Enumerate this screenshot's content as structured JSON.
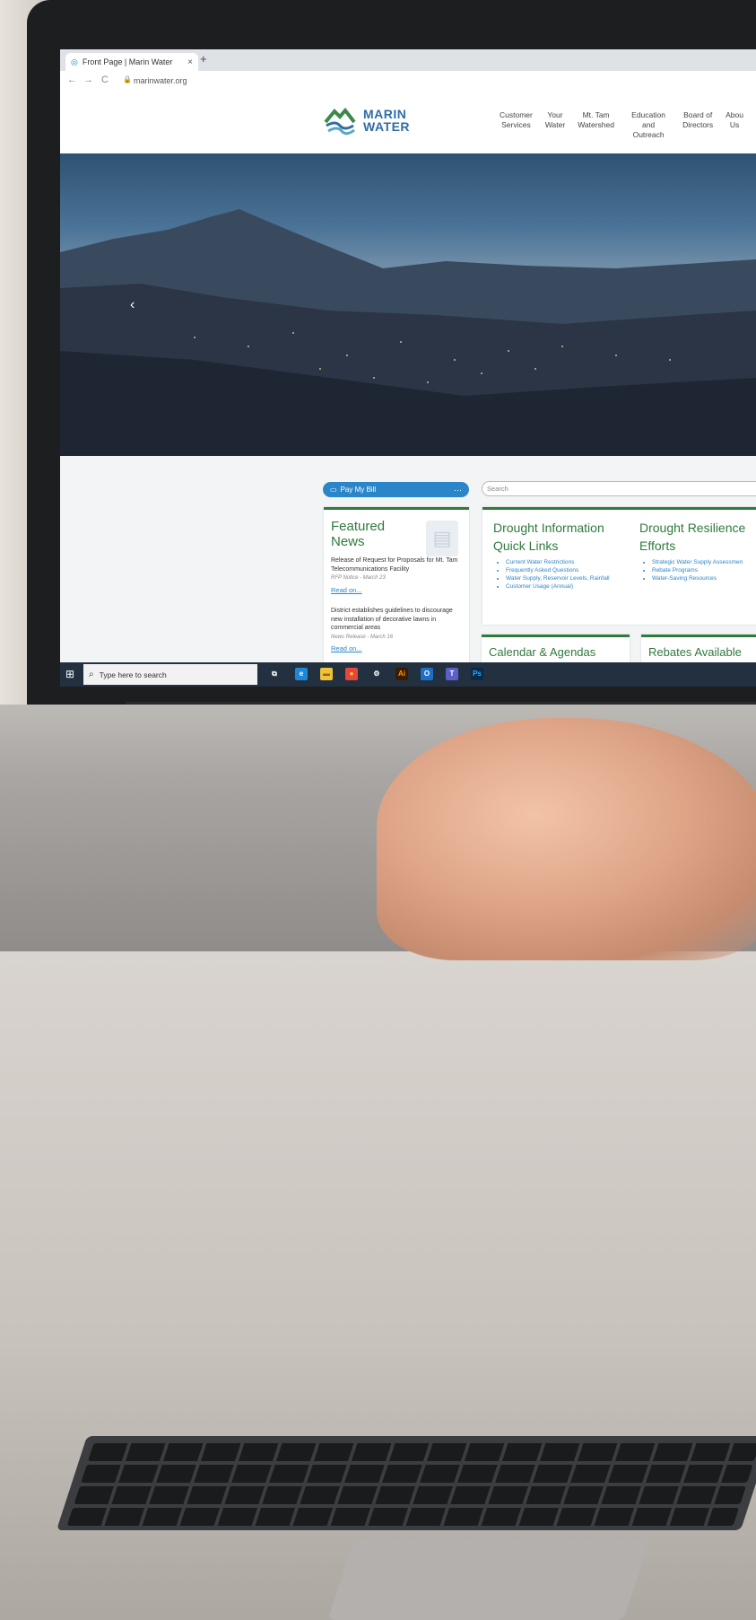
{
  "browser": {
    "tab_title": "Front Page | Marin Water",
    "tab_close": "×",
    "new_tab": "+",
    "url": "marinwater.org",
    "nav_back": "←",
    "nav_forward": "→",
    "nav_reload": "C"
  },
  "site": {
    "logo_line1": "MARIN",
    "logo_line2": "WATER",
    "nav": [
      {
        "label": "Customer\nServices"
      },
      {
        "label": "Your\nWater"
      },
      {
        "label": "Mt. Tam\nWatershed"
      },
      {
        "label": "Education and\nOutreach"
      },
      {
        "label": "Board of\nDirectors"
      },
      {
        "label": "Abou\nUs"
      }
    ],
    "hero_prev": "‹"
  },
  "main": {
    "pay_bill": "Pay My Bill",
    "pay_bill_more": "···",
    "search_placeholder": "Search",
    "featured": {
      "title": "Featured\nNews",
      "items": [
        {
          "text": "Release of Request for Proposals for Mt. Tam Telecommunications Facility",
          "meta": "RFP Notice - March 23",
          "read": "Read on..."
        },
        {
          "text": "District establishes guidelines to discourage new installation of decorative lawns in commercial areas",
          "meta": "News Release - March 16",
          "read": "Read on..."
        }
      ]
    },
    "drought_info": {
      "title": "Drought Information\nQuick Links",
      "links": [
        "Current Water Restrictions",
        "Frequently Asked Questions",
        "Water Supply, Reservoir Levels, Rainfall",
        "Customer Usage (Annual)"
      ]
    },
    "drought_resilience": {
      "title": "Drought Resilience\nEfforts",
      "links": [
        "Strategic Water Supply Assessmen",
        "Rebate Programs",
        "Water-Saving Resources"
      ]
    },
    "calendar_title": "Calendar & Agendas",
    "rebates_title": "Rebates Available"
  },
  "taskbar": {
    "search_placeholder": "Type here to search",
    "icons": [
      {
        "name": "task-view-icon",
        "glyph": "⧉",
        "color": "#223040"
      },
      {
        "name": "edge-icon",
        "glyph": "e",
        "color": "#1e88d6"
      },
      {
        "name": "file-explorer-icon",
        "glyph": "▬",
        "color": "#f0c23b"
      },
      {
        "name": "chrome-icon",
        "glyph": "●",
        "color": "#e5473b"
      },
      {
        "name": "settings-icon",
        "glyph": "⚙",
        "color": "#223040"
      },
      {
        "name": "illustrator-icon",
        "glyph": "Ai",
        "color": "#3a1c00"
      },
      {
        "name": "outlook-icon",
        "glyph": "O",
        "color": "#1f6ec7"
      },
      {
        "name": "teams-icon",
        "glyph": "T",
        "color": "#5b5fc7"
      },
      {
        "name": "photoshop-icon",
        "glyph": "Ps",
        "color": "#0a2a4a"
      }
    ]
  }
}
